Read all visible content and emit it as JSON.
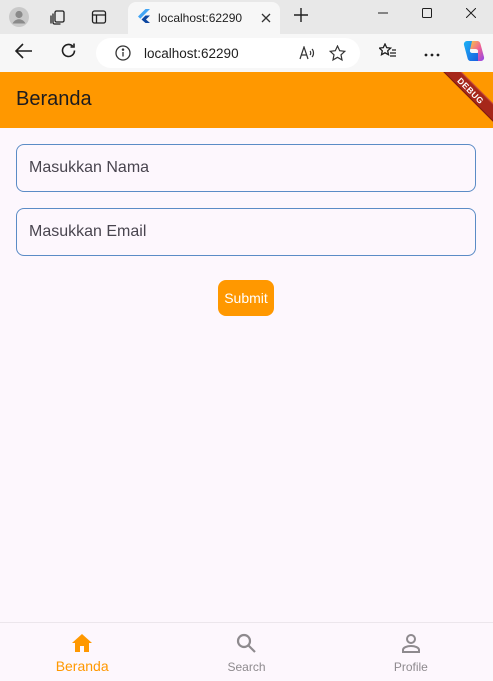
{
  "browser": {
    "tab_title": "localhost:62290",
    "address": "localhost:62290",
    "icons": {
      "profile": "profile-icon",
      "workspaces": "workspaces-icon",
      "tab_actions": "tab-actions-icon",
      "favicon": "flutter-icon",
      "close_tab": "close-icon",
      "new_tab": "plus-icon",
      "minimize": "minimize-icon",
      "maximize": "maximize-icon",
      "close_window": "close-icon",
      "back": "back-arrow-icon",
      "refresh": "refresh-icon",
      "info": "info-icon",
      "read_aloud": "read-aloud-icon",
      "favorite": "star-icon",
      "favorites": "favorites-icon",
      "more": "more-icon",
      "copilot": "copilot-icon"
    }
  },
  "app": {
    "title": "Beranda",
    "debug_banner": "DEBUG",
    "accent_color": "#ff9800",
    "form": {
      "name_placeholder": "Masukkan Nama",
      "email_placeholder": "Masukkan Email",
      "submit_label": "Submit"
    },
    "bottom_nav": [
      {
        "label": "Beranda",
        "icon": "home-icon",
        "active": true
      },
      {
        "label": "Search",
        "icon": "search-icon",
        "active": false
      },
      {
        "label": "Profile",
        "icon": "person-icon",
        "active": false
      }
    ]
  }
}
